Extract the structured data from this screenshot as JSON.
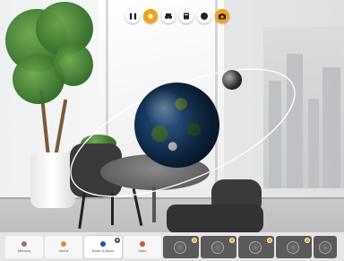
{
  "toolbar": {
    "buttons": [
      {
        "name": "pause-icon",
        "glyph": "❚❚",
        "active": false
      },
      {
        "name": "sun-icon",
        "glyph": "",
        "active": true
      },
      {
        "name": "binoculars-icon",
        "glyph": "",
        "active": false
      },
      {
        "name": "book-icon",
        "glyph": "",
        "active": false
      },
      {
        "name": "compass-icon",
        "glyph": "",
        "active": false
      },
      {
        "name": "camera-icon",
        "glyph": "",
        "active": true
      }
    ]
  },
  "tray": {
    "bodies": [
      {
        "label": "Mercury",
        "color": "#8c7b6a",
        "selected": false
      },
      {
        "label": "Venus",
        "color": "#e38b2b",
        "selected": false
      },
      {
        "label": "Earth & Moon",
        "color": "#1f4fa8",
        "selected": true
      },
      {
        "label": "Mars",
        "color": "#c9572f",
        "selected": false
      }
    ],
    "thumbnails": 5
  },
  "colors": {
    "accent": "#f2a21b",
    "earth": "#1f4fa8"
  }
}
